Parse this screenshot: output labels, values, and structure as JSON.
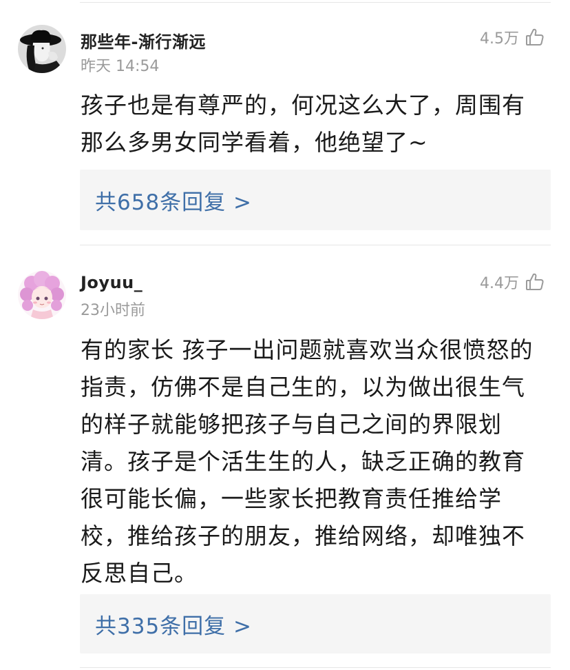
{
  "comments": [
    {
      "username": "那些年-渐行渐远",
      "time": "昨天 14:54",
      "likes": "4.5万",
      "text": "孩子也是有尊严的，何况这么大了，周围有那么多男女同学看着，他绝望了~",
      "replies": "共658条回复 >",
      "avatar_icon": "black-hat-portrait-avatar"
    },
    {
      "username": "Joyuu_",
      "time": "23小时前",
      "likes": "4.4万",
      "text": "有的家长 孩子一出问题就喜欢当众很愤怒的指责，仿佛不是自己生的，以为做出很生气的样子就能够把孩子与自己之间的界限划清。孩子是个活生生的人，缺乏正确的教育很可能长偏，一些家长把教育责任推给学校，推给孩子的朋友，推给网络，却唯独不反思自己。",
      "replies": "共335条回复 >",
      "avatar_icon": "pink-hair-girl-avatar"
    }
  ],
  "colors": {
    "link": "#3f6fa8",
    "muted": "#9a9a9a",
    "reply_bg": "#f5f5f5"
  }
}
